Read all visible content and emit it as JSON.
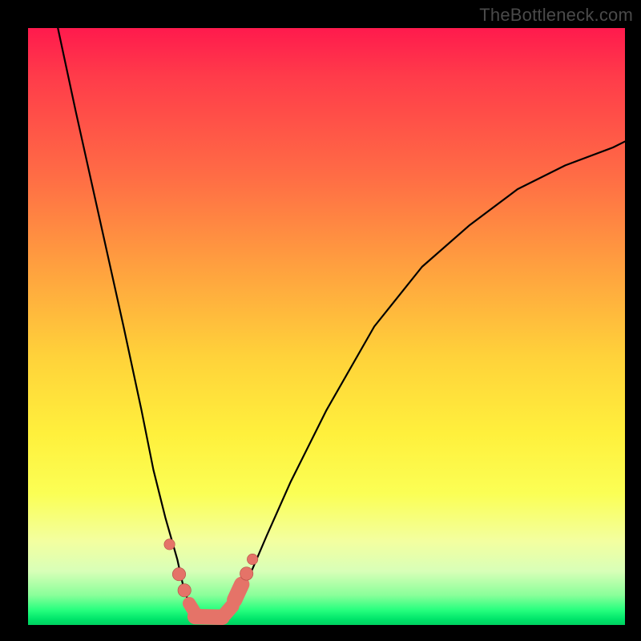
{
  "watermark": "TheBottleneck.com",
  "colors": {
    "gradient_top": "#ff1a4d",
    "gradient_mid": "#ffd23a",
    "gradient_bottom": "#00d060",
    "curve": "#000000",
    "marker_fill": "#e57368",
    "marker_stroke": "#b24a42",
    "frame": "#000000"
  },
  "chart_data": {
    "type": "line",
    "title": "",
    "xlabel": "",
    "ylabel": "",
    "xlim": [
      0,
      100
    ],
    "ylim": [
      0,
      100
    ],
    "grid": false,
    "legend": false,
    "annotations": [],
    "series": [
      {
        "name": "bottleneck-curve",
        "x": [
          5,
          8,
          12,
          16,
          19,
          21,
          23,
          25,
          26,
          27,
          27.5,
          28,
          29,
          30.5,
          32,
          33.5,
          35,
          37,
          40,
          44,
          50,
          58,
          66,
          74,
          82,
          90,
          98,
          100
        ],
        "y": [
          100,
          86,
          68,
          50,
          36,
          26,
          18,
          11,
          6.5,
          3.5,
          2,
          1.3,
          1.1,
          1.1,
          1.3,
          2.2,
          4,
          8,
          15,
          24,
          36,
          50,
          60,
          67,
          73,
          77,
          80,
          81
        ]
      }
    ],
    "markers": [
      {
        "kind": "dot",
        "x": 23.7,
        "y": 13.5,
        "r": 0.9
      },
      {
        "kind": "dot",
        "x": 25.3,
        "y": 8.5,
        "r": 1.1
      },
      {
        "kind": "dot",
        "x": 26.2,
        "y": 5.8,
        "r": 1.1
      },
      {
        "kind": "pill",
        "x1": 27.0,
        "y1": 3.6,
        "x2": 28.0,
        "y2": 2.0,
        "r": 1.1
      },
      {
        "kind": "pill",
        "x1": 28.0,
        "y1": 1.4,
        "x2": 32.5,
        "y2": 1.3,
        "r": 1.3
      },
      {
        "kind": "pill",
        "x1": 33.0,
        "y1": 1.8,
        "x2": 34.2,
        "y2": 3.2,
        "r": 1.2
      },
      {
        "kind": "pill",
        "x1": 34.6,
        "y1": 4.2,
        "x2": 35.8,
        "y2": 6.8,
        "r": 1.3
      },
      {
        "kind": "dot",
        "x": 36.6,
        "y": 8.6,
        "r": 1.1
      },
      {
        "kind": "dot",
        "x": 37.6,
        "y": 11.0,
        "r": 0.9
      }
    ]
  }
}
